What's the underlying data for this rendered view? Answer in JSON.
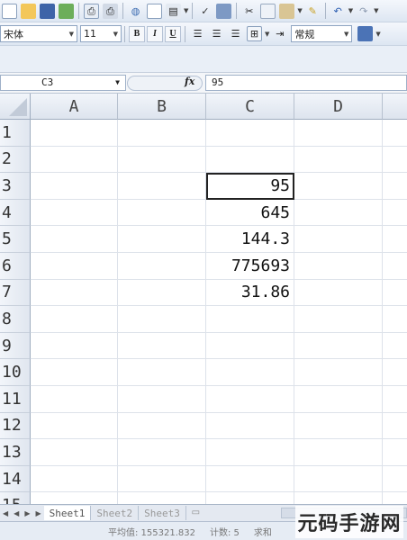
{
  "toolbar": {
    "font_name": "宋体",
    "font_size": "11",
    "bold_label": "B",
    "italic_label": "I",
    "underline_label": "U",
    "number_format": "常规"
  },
  "formula_bar": {
    "cell_ref": "C3",
    "fx_label": "fx",
    "value": "95"
  },
  "columns": [
    "A",
    "B",
    "C",
    "D"
  ],
  "rows": [
    "1",
    "2",
    "3",
    "4",
    "5",
    "6",
    "7",
    "8",
    "9",
    "10",
    "11",
    "12",
    "13",
    "14",
    "15"
  ],
  "cells": {
    "C3": "95",
    "C4": "645",
    "C5": "144.3",
    "C6": "775693",
    "C7": "31.86"
  },
  "sheet_tabs": [
    "Sheet1",
    "Sheet2",
    "Sheet3"
  ],
  "status": {
    "average": "平均值: 155321.832",
    "count": "计数: 5",
    "sum": "求和"
  },
  "watermark": "元码手游网"
}
